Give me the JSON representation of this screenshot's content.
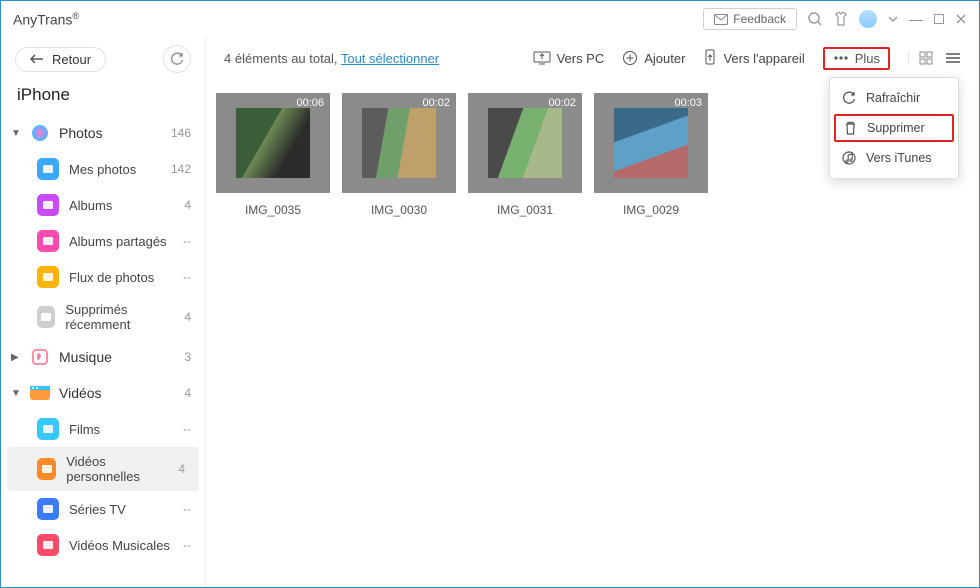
{
  "app": {
    "name": "AnyTrans",
    "reg": "®"
  },
  "titlebar": {
    "feedback": "Feedback"
  },
  "sidebar": {
    "back": "Retour",
    "device": "iPhone",
    "groups": [
      {
        "label": "Photos",
        "count": "146",
        "expanded": true,
        "items": [
          {
            "label": "Mes photos",
            "count": "142",
            "icon_bg": "#3aa8ff"
          },
          {
            "label": "Albums",
            "count": "4",
            "icon_bg": "#c84bff"
          },
          {
            "label": "Albums partagés",
            "count": "--",
            "icon_bg": "#ff4bb0"
          },
          {
            "label": "Flux de photos",
            "count": "--",
            "icon_bg": "#ffb400"
          },
          {
            "label": "Supprimés récemment",
            "count": "4",
            "icon_bg": "#cfcfcf"
          }
        ]
      },
      {
        "label": "Musique",
        "count": "3",
        "expanded": false,
        "items": []
      },
      {
        "label": "Vidéos",
        "count": "4",
        "expanded": true,
        "items": [
          {
            "label": "Films",
            "count": "--",
            "icon_bg": "#37c8ff"
          },
          {
            "label": "Vidéos personnelles",
            "count": "4",
            "icon_bg": "#ff8a2a",
            "selected": true
          },
          {
            "label": "Séries TV",
            "count": "--",
            "icon_bg": "#3a7bff"
          },
          {
            "label": "Vidéos Musicales",
            "count": "--",
            "icon_bg": "#ff4b6a"
          }
        ]
      }
    ]
  },
  "toolbar": {
    "summary_prefix": "4 éléments au total, ",
    "select_all": "Tout sélectionner",
    "to_pc": "Vers PC",
    "add": "Ajouter",
    "to_device": "Vers l'appareil",
    "more": "Plus"
  },
  "menu": {
    "refresh": "Rafraîchir",
    "delete": "Supprimer",
    "itunes": "Vers iTunes"
  },
  "videos": [
    {
      "name": "IMG_0035",
      "duration": "00:06",
      "bg": "linear-gradient(120deg,#3b5d3a 40%,#6d8a53 41%,#2b2b2b 70%)"
    },
    {
      "name": "IMG_0030",
      "duration": "00:02",
      "bg": "linear-gradient(100deg,#5c5c5c 30%,#6fa06a 31% 55%,#bfa06a 56%)"
    },
    {
      "name": "IMG_0031",
      "duration": "00:02",
      "bg": "linear-gradient(110deg,#4a4a4a 35%,#78b070 36% 60%,#a7b98a 61%)"
    },
    {
      "name": "IMG_0029",
      "duration": "00:03",
      "bg": "linear-gradient(160deg,#3a6a8a 35%,#5fa0c8 36% 65%,#b56a6a 66%)"
    }
  ]
}
